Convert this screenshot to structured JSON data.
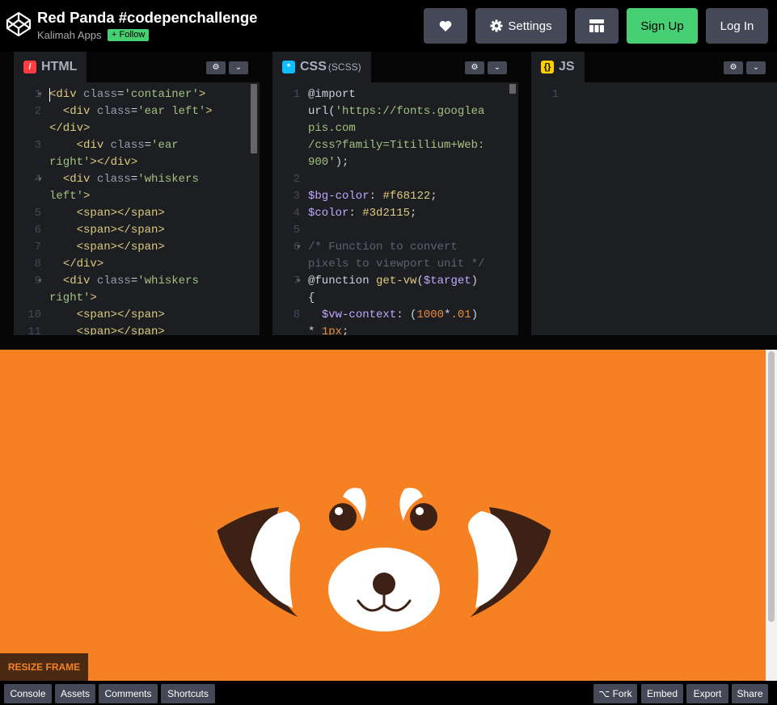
{
  "header": {
    "title": "Red Panda #codepenchallenge",
    "author": "Kalimah Apps",
    "follow_label": "+ Follow",
    "buttons": {
      "heart_icon": "heart-icon",
      "settings_label": "Settings",
      "layout_icon": "layout-grid-icon",
      "signup_label": "Sign Up",
      "login_label": "Log In"
    }
  },
  "editors": {
    "html": {
      "label": "HTML",
      "badge": "/",
      "badge_color": "#ff3c41"
    },
    "css": {
      "label": "CSS",
      "sub": "(SCSS)",
      "badge": "*",
      "badge_color": "#0ebeff"
    },
    "js": {
      "label": "JS",
      "badge": "{}",
      "badge_color": "#fcd000"
    }
  },
  "html_code": [
    {
      "num": "1",
      "fold": true,
      "parts": [
        [
          "t",
          "<div"
        ],
        [
          "a",
          " class"
        ],
        [
          "pl",
          "="
        ],
        [
          "s",
          "'container'"
        ],
        [
          "t",
          ">"
        ]
      ]
    },
    {
      "num": "2",
      "parts": [
        [
          "pl",
          "  "
        ],
        [
          "t",
          "<div"
        ],
        [
          "a",
          " class"
        ],
        [
          "pl",
          "="
        ],
        [
          "s",
          "'ear left'"
        ],
        [
          "t",
          ">"
        ]
      ]
    },
    {
      "num": "",
      "parts": [
        [
          "t",
          "</div>"
        ]
      ]
    },
    {
      "num": "3",
      "parts": [
        [
          "pl",
          "    "
        ],
        [
          "t",
          "<div"
        ],
        [
          "a",
          " class"
        ],
        [
          "pl",
          "="
        ],
        [
          "s",
          "'ear"
        ]
      ]
    },
    {
      "num": "",
      "parts": [
        [
          "s",
          "right'"
        ],
        [
          "t",
          "></div>"
        ]
      ]
    },
    {
      "num": "4",
      "fold": true,
      "parts": [
        [
          "pl",
          "  "
        ],
        [
          "t",
          "<div"
        ],
        [
          "a",
          " class"
        ],
        [
          "pl",
          "="
        ],
        [
          "s",
          "'whiskers"
        ]
      ]
    },
    {
      "num": "",
      "parts": [
        [
          "s",
          "left'"
        ],
        [
          "t",
          ">"
        ]
      ]
    },
    {
      "num": "5",
      "parts": [
        [
          "pl",
          "    "
        ],
        [
          "t",
          "<span></span>"
        ]
      ]
    },
    {
      "num": "6",
      "parts": [
        [
          "pl",
          "    "
        ],
        [
          "t",
          "<span></span>"
        ]
      ]
    },
    {
      "num": "7",
      "parts": [
        [
          "pl",
          "    "
        ],
        [
          "t",
          "<span></span>"
        ]
      ]
    },
    {
      "num": "8",
      "parts": [
        [
          "pl",
          "  "
        ],
        [
          "t",
          "</div>"
        ]
      ]
    },
    {
      "num": "9",
      "fold": true,
      "parts": [
        [
          "pl",
          "  "
        ],
        [
          "t",
          "<div"
        ],
        [
          "a",
          " class"
        ],
        [
          "pl",
          "="
        ],
        [
          "s",
          "'whiskers"
        ]
      ]
    },
    {
      "num": "",
      "parts": [
        [
          "s",
          "right'"
        ],
        [
          "t",
          ">"
        ]
      ]
    },
    {
      "num": "10",
      "parts": [
        [
          "pl",
          "    "
        ],
        [
          "t",
          "<span></span>"
        ]
      ]
    },
    {
      "num": "11",
      "parts": [
        [
          "pl",
          "    "
        ],
        [
          "t",
          "<span></span>"
        ]
      ]
    }
  ],
  "css_code": [
    {
      "num": "1",
      "parts": [
        [
          "kw",
          "@import"
        ]
      ]
    },
    {
      "num": "",
      "parts": [
        [
          "kw",
          "url("
        ],
        [
          "s",
          "'https://fonts.googlea"
        ]
      ]
    },
    {
      "num": "",
      "parts": [
        [
          "s",
          "pis.com"
        ]
      ]
    },
    {
      "num": "",
      "parts": [
        [
          "s",
          "/css?family=Titillium+Web:"
        ]
      ]
    },
    {
      "num": "",
      "parts": [
        [
          "s",
          "900'"
        ],
        [
          "kw",
          ");"
        ]
      ]
    },
    {
      "num": "2",
      "parts": []
    },
    {
      "num": "3",
      "parts": [
        [
          "vr",
          "$bg-color"
        ],
        [
          "kw",
          ": "
        ],
        [
          "hx",
          "#f68122"
        ],
        [
          "kw",
          ";"
        ]
      ]
    },
    {
      "num": "4",
      "parts": [
        [
          "vr",
          "$color"
        ],
        [
          "kw",
          ": "
        ],
        [
          "hx",
          "#3d2115"
        ],
        [
          "kw",
          ";"
        ]
      ]
    },
    {
      "num": "5",
      "parts": []
    },
    {
      "num": "6",
      "fold": true,
      "parts": [
        [
          "cm",
          "/* Function to convert"
        ]
      ]
    },
    {
      "num": "",
      "parts": [
        [
          "cm",
          "pixels to viewport unit */"
        ]
      ]
    },
    {
      "num": "7",
      "fold": true,
      "parts": [
        [
          "kw",
          "@function "
        ],
        [
          "fn",
          "get-vw"
        ],
        [
          "kw",
          "("
        ],
        [
          "vr",
          "$target"
        ],
        [
          "kw",
          ")"
        ]
      ]
    },
    {
      "num": "",
      "parts": [
        [
          "kw",
          "{"
        ]
      ]
    },
    {
      "num": "8",
      "parts": [
        [
          "kw",
          "  "
        ],
        [
          "vr",
          "$vw-context"
        ],
        [
          "kw",
          ": ("
        ],
        [
          "nm",
          "1000"
        ],
        [
          "kw",
          "*"
        ],
        [
          "nm",
          ".01"
        ],
        [
          "kw",
          ")"
        ]
      ]
    },
    {
      "num": "",
      "parts": [
        [
          "kw",
          "* "
        ],
        [
          "nm",
          "1px"
        ],
        [
          "kw",
          ";"
        ]
      ]
    }
  ],
  "js_code": [
    {
      "num": "1",
      "parts": []
    }
  ],
  "preview": {
    "bg_color": "#f68122",
    "panda_color": "#3d2115",
    "resize_label": "RESIZE FRAME"
  },
  "footer": {
    "console_label": "Console",
    "assets_label": "Assets",
    "comments_label": "Comments",
    "shortcuts_label": "Shortcuts",
    "fork_label": "Fork",
    "embed_label": "Embed",
    "export_label": "Export",
    "share_label": "Share"
  }
}
